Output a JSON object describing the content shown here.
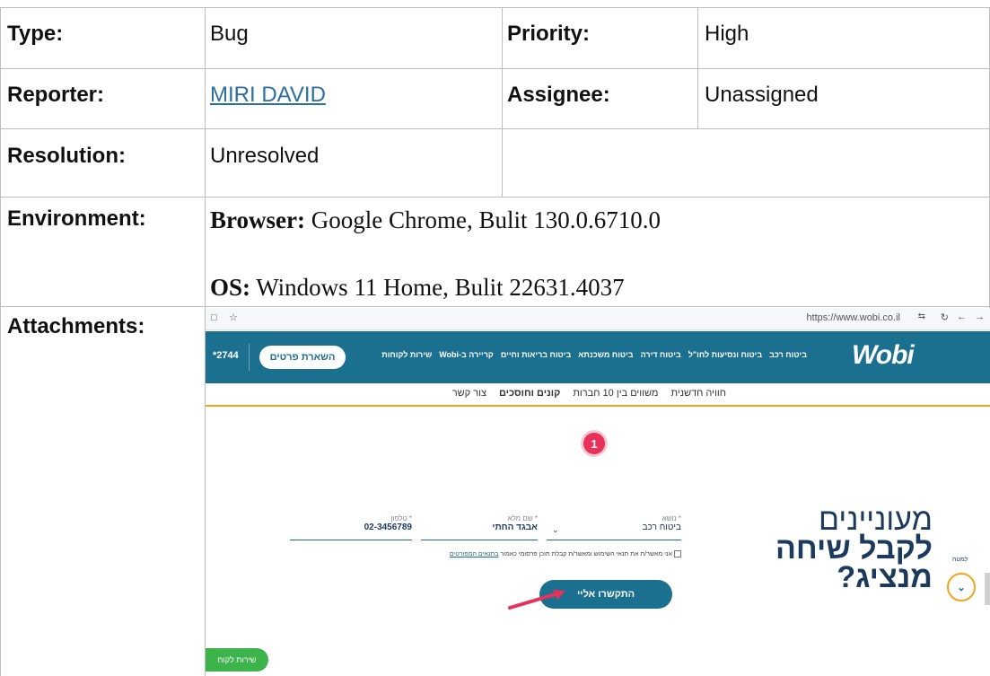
{
  "fields": {
    "type_label": "Type:",
    "type_value": "Bug",
    "priority_label": "Priority:",
    "priority_value": "High",
    "reporter_label": "Reporter:",
    "reporter_value": "MIRI DAVID",
    "assignee_label": "Assignee:",
    "assignee_value": "Unassigned",
    "resolution_label": "Resolution:",
    "resolution_value": "Unresolved",
    "environment_label": "Environment:",
    "env_browser_label": "Browser:",
    "env_browser_value": " Google Chrome, Bulit 130.0.6710.0",
    "env_os_label": "OS:",
    "env_os_value": " Windows 11 Home, Bulit 22631.4037",
    "attachments_label": "Attachments:"
  },
  "attachment": {
    "url": "https://www.wobi.co.il",
    "logo": "Wobi",
    "phone_short": "*2744",
    "leave_details_btn": "השארת פרטים",
    "nav_items": [
      "ביטוח רכב",
      "ביטוח ונסיעות לחו\"ל",
      "ביטוח דירה",
      "ביטוח משכנתא",
      "ביטוח בריאות וחיים",
      "קריירה ב-Wobi",
      "שירות לקוחות"
    ],
    "subnav_items": [
      "חוויה חדשנית",
      "משווים בין 10 חברות",
      "קונים וחוסכים",
      "צור קשר"
    ],
    "step_number": "1",
    "headline_1": "מעוניינים",
    "headline_2": "לקבל שיחה",
    "headline_3": "מנציג?",
    "subject_label": "* נושא",
    "subject_value": "ביטוח רכב",
    "name_label": "* שם מלא",
    "name_value": "אבגד החתי",
    "phone_label": "* טלפון",
    "phone_value": "02-3456789",
    "consent_text": "אני מאשר/ת את תנאי השימוש ומאשר/ת קבלת תוכן פרסומי כאמור",
    "consent_link": "בתנאים המפורטים",
    "call_me_btn": "התקשרו אליי",
    "scroll_down_label": "למטה",
    "customer_service_btn": "שירות לקוח"
  },
  "colors": {
    "link": "#2a6f9f",
    "nav": "#1b6f8f",
    "accent": "#f6a21a",
    "step": "#e8325a",
    "cta": "#1b6f8f",
    "service": "#3cb44b"
  }
}
